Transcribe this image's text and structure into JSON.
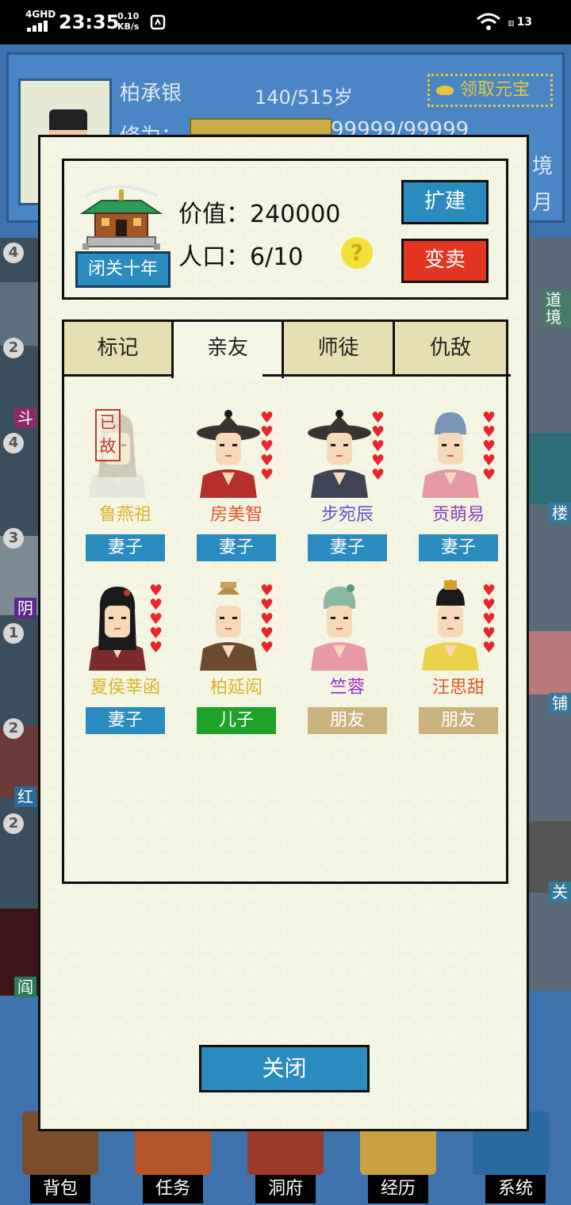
{
  "status_bar": {
    "network": "4GHD",
    "time": "23:35",
    "speed_value": "0.10",
    "speed_unit": "KB/s",
    "battery": "13"
  },
  "background": {
    "player_name": "柏承银",
    "age": "140/515岁",
    "claim_yuanbao_label": "领取元宝",
    "cultivation_label": "修为：",
    "cultivation_value": "99999/99999",
    "realm_fragment": "境",
    "month_fragment": "月",
    "left_badges": [
      "4",
      "2",
      "4",
      "3",
      "1",
      "2",
      "2"
    ],
    "left_tags": [
      "斗",
      "阴",
      "红",
      "阎"
    ],
    "right_tags": [
      "道\n境",
      "楼",
      "铺",
      "关"
    ],
    "bottom_nav": [
      "背包",
      "任务",
      "洞府",
      "经历",
      "系统"
    ]
  },
  "modal": {
    "closed_door_button": "闭关十年",
    "value_label": "价值：",
    "value": "240000",
    "population_label": "人口：",
    "population": "6/10",
    "help_icon": "?",
    "expand_button": "扩建",
    "sell_button": "变卖",
    "tabs": [
      {
        "label": "标记",
        "active": false
      },
      {
        "label": "亲友",
        "active": true
      },
      {
        "label": "师徒",
        "active": false
      },
      {
        "label": "仇敌",
        "active": false
      }
    ],
    "close_button": "关闭"
  },
  "friends": [
    {
      "name": "鲁燕祖",
      "relation": "妻子",
      "name_color": "#d9b52a",
      "relation_color": "#2a8bbf",
      "deceased": true,
      "deceased_label": "已故",
      "hearts": 0,
      "hair": "#8a7a6a",
      "hat": "bun",
      "robe": "#c9cfcb"
    },
    {
      "name": "房美智",
      "relation": "妻子",
      "name_color": "#e2552e",
      "relation_color": "#2a8bbf",
      "deceased": false,
      "hearts": 5,
      "hair": "#1a1a1a",
      "hat": "wide",
      "robe": "#b5302a"
    },
    {
      "name": "步宛辰",
      "relation": "妻子",
      "name_color": "#5d55c8",
      "relation_color": "#2a8bbf",
      "deceased": false,
      "hearts": 5,
      "hair": "#1a1a1a",
      "hat": "wide",
      "robe": "#3f4356"
    },
    {
      "name": "贡萌易",
      "relation": "妻子",
      "name_color": "#8c3fb5",
      "relation_color": "#2a8bbf",
      "deceased": false,
      "hearts": 5,
      "hair": "#1a1a1a",
      "hat": "cap",
      "robe": "#e69aa6"
    },
    {
      "name": "夏侯莘函",
      "relation": "妻子",
      "name_color": "#d9b52a",
      "relation_color": "#2a8bbf",
      "deceased": false,
      "hearts": 5,
      "hair": "#1a1a1a",
      "hat": "long",
      "robe": "#7a2b2b"
    },
    {
      "name": "柏延闳",
      "relation": "儿子",
      "name_color": "#d9b52a",
      "relation_color": "#1ea22a",
      "deceased": false,
      "hearts": 5,
      "hair": "#1a1a1a",
      "hat": "crown",
      "robe": "#6b4a30"
    },
    {
      "name": "竺蓉",
      "relation": "朋友",
      "name_color": "#9a2fc8",
      "relation_color": "#c9b27e",
      "deceased": false,
      "hearts": 0,
      "hair": "#1a1a1a",
      "hat": "flower",
      "robe": "#e69aa6"
    },
    {
      "name": "汪思甜",
      "relation": "朋友",
      "name_color": "#e2552e",
      "relation_color": "#c9b27e",
      "deceased": false,
      "hearts": 5,
      "hair": "#1a1a1a",
      "hat": "ornate",
      "robe": "#e8d34a"
    }
  ]
}
